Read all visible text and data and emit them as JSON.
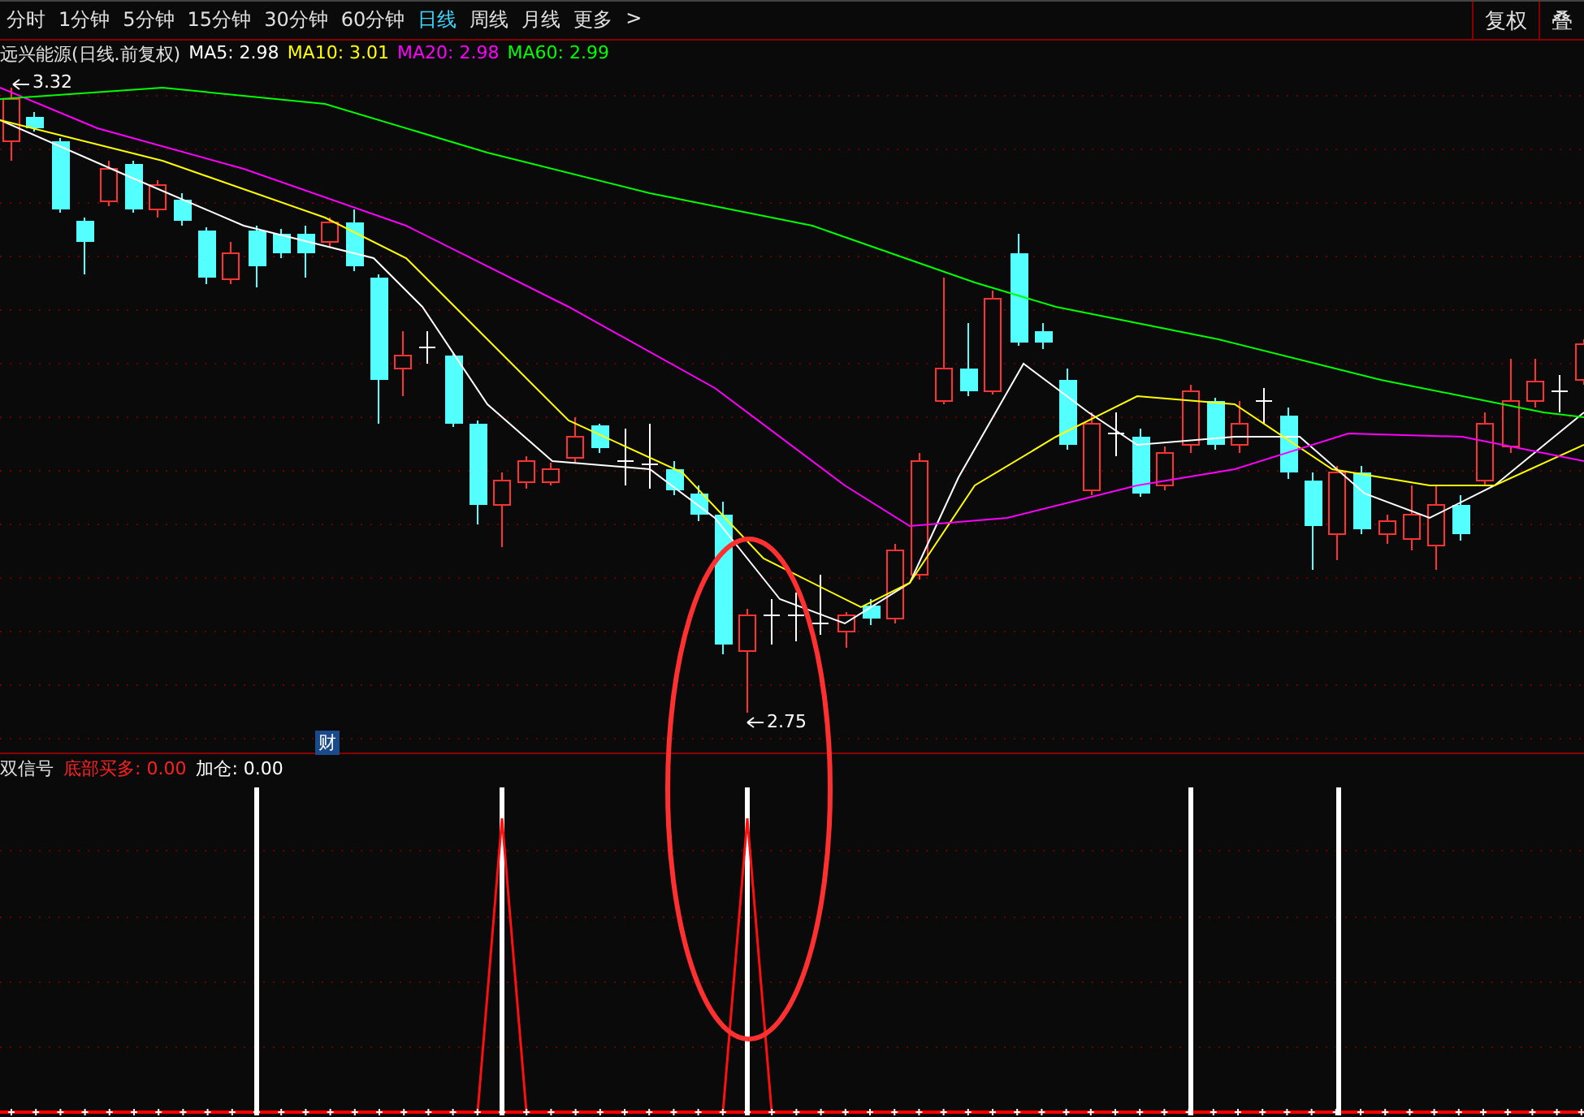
{
  "toolbar": {
    "tabs": [
      {
        "label": "分时",
        "selected": false
      },
      {
        "label": "1分钟",
        "selected": false
      },
      {
        "label": "5分钟",
        "selected": false
      },
      {
        "label": "15分钟",
        "selected": false
      },
      {
        "label": "30分钟",
        "selected": false
      },
      {
        "label": "60分钟",
        "selected": false
      },
      {
        "label": "日线",
        "selected": true
      },
      {
        "label": "周线",
        "selected": false
      },
      {
        "label": "月线",
        "selected": false
      },
      {
        "label": "更多",
        "selected": false
      }
    ],
    "more_chevron": ">",
    "right_buttons": [
      "复权",
      "叠"
    ]
  },
  "price_pane": {
    "title": "远兴能源(日线.前复权)",
    "ma_items": [
      {
        "label": "MA5: 2.98",
        "color": "#ffffff"
      },
      {
        "label": "MA10: 3.01",
        "color": "#ffff00"
      },
      {
        "label": "MA20: 2.98",
        "color": "#ff00ff"
      },
      {
        "label": "MA60: 2.99",
        "color": "#00ff00"
      }
    ],
    "high_label": "3.32",
    "low_label": "2.75",
    "badge": "财"
  },
  "indicator_pane": {
    "name": "双信号",
    "items": [
      {
        "label": "底部买多: 0.00",
        "color": "#ff2020"
      },
      {
        "label": "加仓: 0.00",
        "color": "#ffffff"
      }
    ]
  }
}
